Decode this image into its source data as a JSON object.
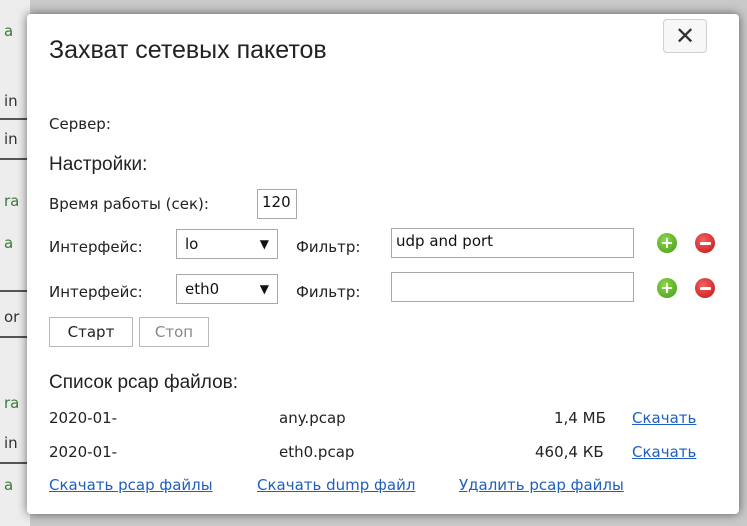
{
  "background": {
    "snippets": [
      "a",
      "in",
      "in",
      "ra",
      "a",
      "or",
      "ra",
      "in",
      "a"
    ]
  },
  "dialog": {
    "title": "Захват сетевых пакетов",
    "close_label": "✕"
  },
  "server": {
    "label": "Сервер:",
    "value": ""
  },
  "settings": {
    "title": "Настройки:",
    "runtime_label": "Время работы (сек):",
    "runtime_value": "120",
    "rows": [
      {
        "interface_label": "Интерфейс:",
        "interface_value": "lo",
        "filter_label": "Фильтр:",
        "filter_value": "udp and port"
      },
      {
        "interface_label": "Интерфейс:",
        "interface_value": "eth0",
        "filter_label": "Фильтр:",
        "filter_value": ""
      }
    ],
    "start_label": "Старт",
    "stop_label": "Стоп"
  },
  "files": {
    "title": "Список pcap файлов:",
    "items": [
      {
        "name_prefix": "2020-01-",
        "name_suffix": "any.pcap",
        "size": "1,4 МБ",
        "download_label": "Скачать"
      },
      {
        "name_prefix": "2020-01-",
        "name_suffix": "eth0.pcap",
        "size": "460,4 КБ",
        "download_label": "Скачать"
      }
    ],
    "actions": {
      "download_pcap": "Скачать pcap файлы",
      "download_dump": "Скачать dump файл",
      "delete_pcap": "Удалить pcap файлы"
    }
  },
  "colors": {
    "link": "#1f5fbf",
    "add": "#5cb82a",
    "remove": "#d62020"
  }
}
